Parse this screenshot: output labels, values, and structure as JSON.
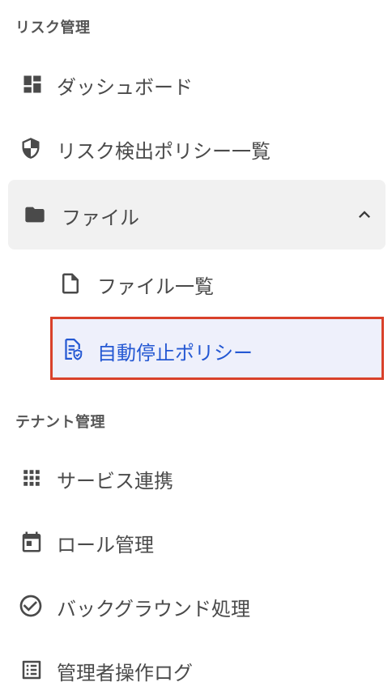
{
  "sections": {
    "risk_management": {
      "header": "リスク管理",
      "items": {
        "dashboard": {
          "label": "ダッシュボード",
          "icon": "dashboard-icon"
        },
        "risk_policy_list": {
          "label": "リスク検出ポリシー一覧",
          "icon": "shield-icon"
        },
        "files": {
          "label": "ファイル",
          "icon": "folder-icon",
          "expanded": true
        },
        "file_list": {
          "label": "ファイル一覧",
          "icon": "document-icon"
        },
        "auto_stop_policy": {
          "label": "自動停止ポリシー",
          "icon": "policy-document-icon",
          "active": true
        }
      }
    },
    "tenant_management": {
      "header": "テナント管理",
      "items": {
        "service_integration": {
          "label": "サービス連携",
          "icon": "apps-grid-icon"
        },
        "role_management": {
          "label": "ロール管理",
          "icon": "calendar-icon"
        },
        "background_processing": {
          "label": "バックグラウンド処理",
          "icon": "check-circle-icon"
        },
        "admin_log": {
          "label": "管理者操作ログ",
          "icon": "list-alt-icon"
        }
      }
    }
  },
  "colors": {
    "text": "#4a4a4a",
    "header_text": "#555555",
    "active_text": "#2458d3",
    "active_bg": "#eef0fb",
    "active_border": "#d9412a",
    "expanded_bg": "#f1f1f1"
  }
}
